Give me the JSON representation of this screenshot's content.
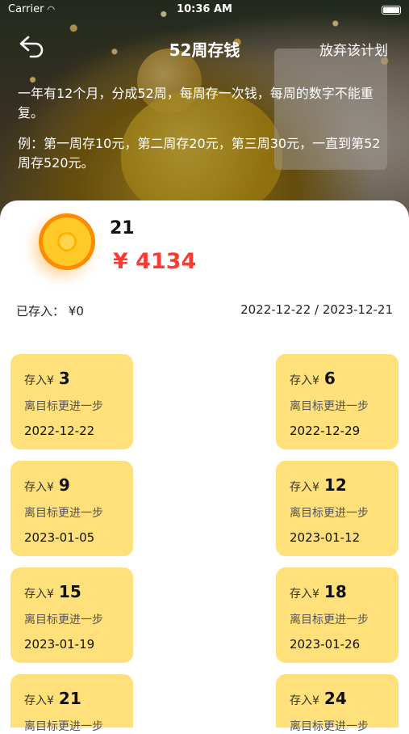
{
  "status_bar": {
    "carrier": "Carrier",
    "time": "10:36 AM"
  },
  "nav": {
    "title": "52周存钱",
    "action": "放弃该计划"
  },
  "description": {
    "line1": "一年有12个月，分成52周，每周存一次钱，每周的数字不能重复。",
    "line2": "例：第一周存10元，第二周存20元，第三周30元，一直到第52周存520元。"
  },
  "goal": {
    "count": "21",
    "amount": "¥ 4134"
  },
  "summary": {
    "saved_label": "已存入：",
    "saved_value": "¥0",
    "date_range": "2022-12-22 / 2023-12-21"
  },
  "cards": [
    {
      "prefix": "存入¥",
      "amount": "3",
      "note": "离目标更进一步",
      "date": "2022-12-22"
    },
    {
      "prefix": "存入¥",
      "amount": "6",
      "note": "离目标更进一步",
      "date": "2022-12-29"
    },
    {
      "prefix": "存入¥",
      "amount": "9",
      "note": "离目标更进一步",
      "date": "2023-01-05"
    },
    {
      "prefix": "存入¥",
      "amount": "12",
      "note": "离目标更进一步",
      "date": "2023-01-12"
    },
    {
      "prefix": "存入¥",
      "amount": "15",
      "note": "离目标更进一步",
      "date": "2023-01-19"
    },
    {
      "prefix": "存入¥",
      "amount": "18",
      "note": "离目标更进一步",
      "date": "2023-01-26"
    },
    {
      "prefix": "存入¥",
      "amount": "21",
      "note": "离目标更进一步",
      "date": ""
    },
    {
      "prefix": "存入¥",
      "amount": "24",
      "note": "离目标更进一步",
      "date": ""
    }
  ]
}
